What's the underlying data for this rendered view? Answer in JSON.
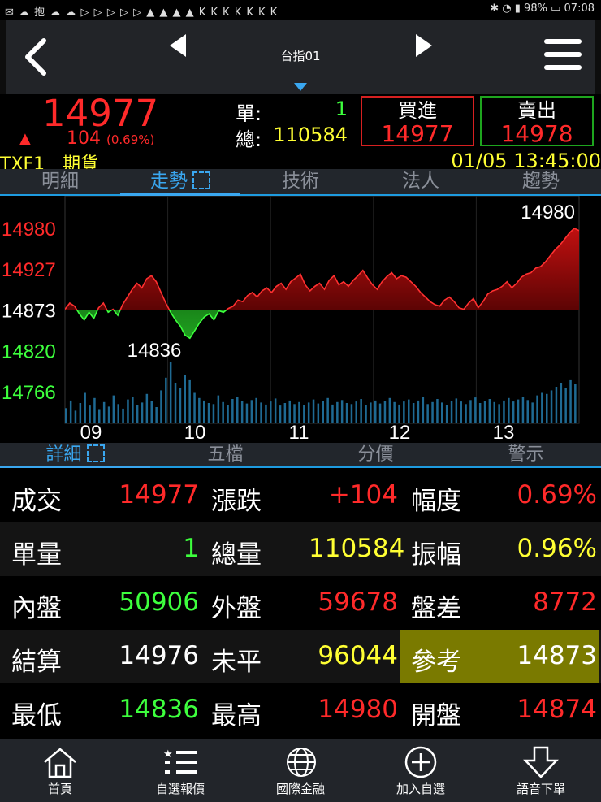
{
  "statusbar": {
    "left_icons": "✉ ☁ 抱 ☁ ☁ ▷ ▷ ▷ ▷ ▷ ▲ ▲ ▲ ▲ K K K K K K K",
    "battery": "98%",
    "time": "07:08"
  },
  "nav": {
    "title": "台指01"
  },
  "quote": {
    "price": "14977",
    "change": "104",
    "change_pct": "(0.69%)",
    "single_label": "單:",
    "single_value": "1",
    "total_label": "總:",
    "total_value": "110584",
    "buy_label": "買進",
    "buy_price": "14977",
    "sell_label": "賣出",
    "sell_price": "14978",
    "symbol": "TXF1　期貨",
    "datetime": "01/05 13:45:00"
  },
  "tabs_top": [
    "明細",
    "走勢",
    "技術",
    "法人",
    "趨勢"
  ],
  "tabs_bottom": [
    "詳細",
    "五檔",
    "分價",
    "警示"
  ],
  "colors": {
    "up": "#ff2a2a",
    "down": "#3dff3d",
    "yellow": "#ffff33",
    "accent": "#3aa7f0"
  },
  "chart_data": {
    "type": "area",
    "reference": 14873,
    "ylim": [
      14766,
      14980
    ],
    "y_ticks": [
      "14980",
      "14927",
      "14873",
      "14820",
      "14766"
    ],
    "x_ticks": [
      "09",
      "10",
      "11",
      "12",
      "13"
    ],
    "annotations": {
      "high": "14980",
      "low": "14836"
    },
    "price_series": [
      14874,
      14882,
      14878,
      14868,
      14860,
      14870,
      14862,
      14876,
      14882,
      14870,
      14874,
      14866,
      14880,
      14890,
      14900,
      14908,
      14902,
      14914,
      14918,
      14910,
      14896,
      14882,
      14870,
      14860,
      14852,
      14840,
      14836,
      14846,
      14856,
      14864,
      14868,
      14860,
      14872,
      14870,
      14875,
      14878,
      14886,
      14884,
      14892,
      14896,
      14890,
      14898,
      14902,
      14896,
      14904,
      14908,
      14900,
      14910,
      14915,
      14920,
      14906,
      14898,
      14904,
      14908,
      14900,
      14912,
      14918,
      14906,
      14910,
      14904,
      14912,
      14918,
      14925,
      14915,
      14906,
      14900,
      14910,
      14917,
      14922,
      14914,
      14918,
      14916,
      14910,
      14904,
      14896,
      14890,
      14884,
      14880,
      14878,
      14886,
      14890,
      14884,
      14876,
      14874,
      14882,
      14888,
      14876,
      14884,
      14894,
      14898,
      14900,
      14904,
      14910,
      14902,
      14908,
      14916,
      14920,
      14922,
      14928,
      14930,
      14936,
      14944,
      14952,
      14958,
      14966,
      14974,
      14980,
      14977
    ],
    "volume_series": [
      30,
      45,
      25,
      40,
      60,
      35,
      50,
      28,
      42,
      33,
      55,
      38,
      29,
      47,
      52,
      36,
      41,
      58,
      44,
      32,
      65,
      90,
      120,
      80,
      70,
      95,
      85,
      60,
      50,
      45,
      40,
      38,
      55,
      42,
      36,
      48,
      52,
      44,
      39,
      46,
      50,
      41,
      37,
      43,
      49,
      35,
      40,
      45,
      38,
      42,
      36,
      41,
      47,
      39,
      44,
      50,
      37,
      42,
      46,
      40,
      38,
      43,
      48,
      36,
      41,
      45,
      39,
      44,
      50,
      42,
      37,
      43,
      47,
      40,
      45,
      52,
      38,
      42,
      48,
      41,
      36,
      44,
      49,
      43,
      38,
      46,
      51,
      40,
      44,
      48,
      42,
      38,
      45,
      50,
      43,
      47,
      52,
      46,
      41,
      55,
      60,
      58,
      65,
      72,
      80,
      70,
      85,
      78
    ]
  },
  "detail": {
    "rows": [
      [
        {
          "label": "成交",
          "value": "14977",
          "color": "#ff2a2a"
        },
        {
          "label": "漲跌",
          "value": "+104",
          "color": "#ff2a2a"
        },
        {
          "label": "幅度",
          "value": "0.69%",
          "color": "#ff2a2a"
        }
      ],
      [
        {
          "label": "單量",
          "value": "1",
          "color": "#3dff3d"
        },
        {
          "label": "總量",
          "value": "110584",
          "color": "#ffff33"
        },
        {
          "label": "振幅",
          "value": "0.96%",
          "color": "#ffff33"
        }
      ],
      [
        {
          "label": "內盤",
          "value": "50906",
          "color": "#3dff3d"
        },
        {
          "label": "外盤",
          "value": "59678",
          "color": "#ff2a2a"
        },
        {
          "label": "盤差",
          "value": "8772",
          "color": "#ff2a2a"
        }
      ],
      [
        {
          "label": "結算",
          "value": "14976",
          "color": "#ffffff"
        },
        {
          "label": "未平",
          "value": "96044",
          "color": "#ffff33"
        },
        {
          "label": "參考",
          "value": "14873",
          "color": "#ffffff"
        }
      ],
      [
        {
          "label": "最低",
          "value": "14836",
          "color": "#3dff3d"
        },
        {
          "label": "最高",
          "value": "14980",
          "color": "#ff2a2a"
        },
        {
          "label": "開盤",
          "value": "14874",
          "color": "#ff2a2a"
        }
      ]
    ]
  },
  "footer": [
    "首頁",
    "自選報價",
    "國際金融",
    "加入自選",
    "語音下單"
  ]
}
